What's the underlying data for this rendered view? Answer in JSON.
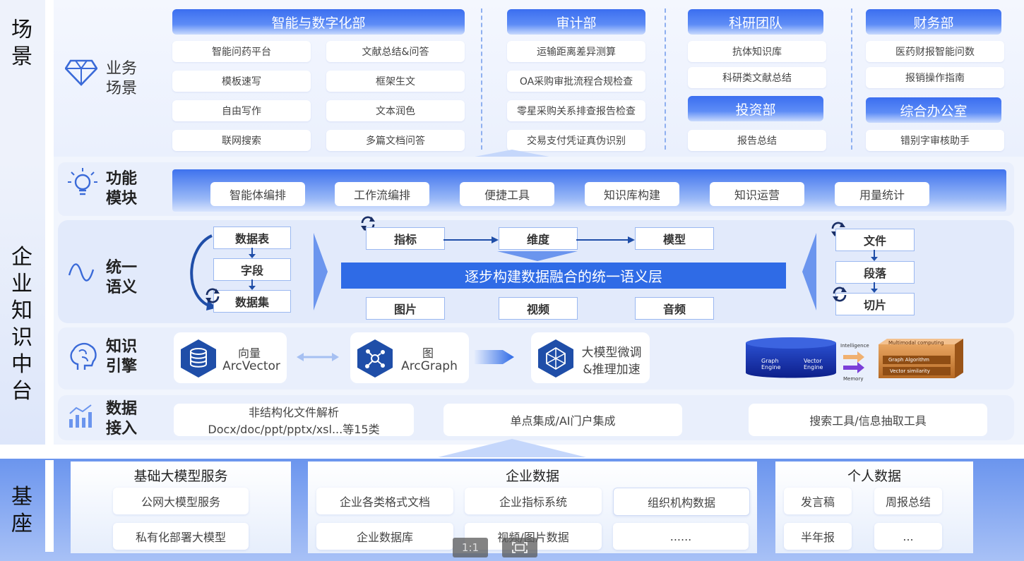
{
  "sections": {
    "scene": "场景",
    "platform": "企业知识中台",
    "base": "基座"
  },
  "scene": {
    "label": "业务场景",
    "depts": {
      "digital": "智能与数字化部",
      "audit": "审计部",
      "research": "科研团队",
      "finance": "财务部",
      "invest": "投资部",
      "office": "综合办公室"
    },
    "digital_items": [
      "智能问药平台",
      "文献总结&问答",
      "模板速写",
      "框架生文",
      "自由写作",
      "文本润色",
      "联网搜索",
      "多篇文档问答"
    ],
    "audit_items": [
      "运输距离差异测算",
      "OA采购审批流程合规检查",
      "零星采购关系排查报告检查",
      "交易支付凭证真伪识别"
    ],
    "research_items": [
      "抗体知识库",
      "科研类文献总结"
    ],
    "invest_items": [
      "报告总结"
    ],
    "finance_items": [
      "医药财报智能问数",
      "报销操作指南"
    ],
    "office_items": [
      "错别字审核助手"
    ]
  },
  "func": {
    "label": "功能模块",
    "items": [
      "智能体编排",
      "工作流编排",
      "便捷工具",
      "知识库构建",
      "知识运营",
      "用量统计"
    ]
  },
  "semantic": {
    "label": "统一语义",
    "left": [
      "数据表",
      "字段",
      "数据集"
    ],
    "top": [
      "指标",
      "维度",
      "模型"
    ],
    "center": "逐步构建数据融合的统一语义层",
    "bottom": [
      "图片",
      "视频",
      "音频"
    ],
    "right": [
      "文件",
      "段落",
      "切片"
    ]
  },
  "engine": {
    "label": "知识引擎",
    "vector_cn": "向量",
    "vector_en": "ArcVector",
    "graph_cn": "图",
    "graph_en": "ArcGraph",
    "llm_line1": "大模型微调",
    "llm_line2": "&推理加速",
    "diagram": {
      "intelligence": "Intelligence",
      "memory": "Memory",
      "multimodal": "Multimodal computing",
      "graph_algo": "Graph Algorithm",
      "vector_sim": "Vector similarity",
      "graph_engine_1": "Graph",
      "graph_engine_2": "Engine",
      "vector_engine_1": "Vector",
      "vector_engine_2": "Engine"
    }
  },
  "ingest": {
    "label": "数据接入",
    "items": [
      {
        "line1": "非结构化文件解析",
        "line2": "Docx/doc/ppt/pptx/xsl...等15类"
      },
      {
        "line1": "单点集成/AI门户集成",
        "line2": ""
      },
      {
        "line1": "搜索工具/信息抽取工具",
        "line2": ""
      }
    ]
  },
  "base": {
    "model_title": "基础大模型服务",
    "model_items": [
      "公网大模型服务",
      "私有化部署大模型"
    ],
    "enterprise_title": "企业数据",
    "enterprise_items": [
      "企业各类格式文档",
      "企业指标系统",
      "组织机构数据",
      "企业数据库",
      "视频/图片数据",
      "......"
    ],
    "personal_title": "个人数据",
    "personal_items": [
      "发言稿",
      "周报总结",
      "半年报",
      "..."
    ]
  },
  "toolbar": {
    "ratio": "1:1"
  },
  "colors": {
    "accent": "#3b6ef0",
    "bar": "#2f6be6",
    "band": "#e8eefc"
  }
}
